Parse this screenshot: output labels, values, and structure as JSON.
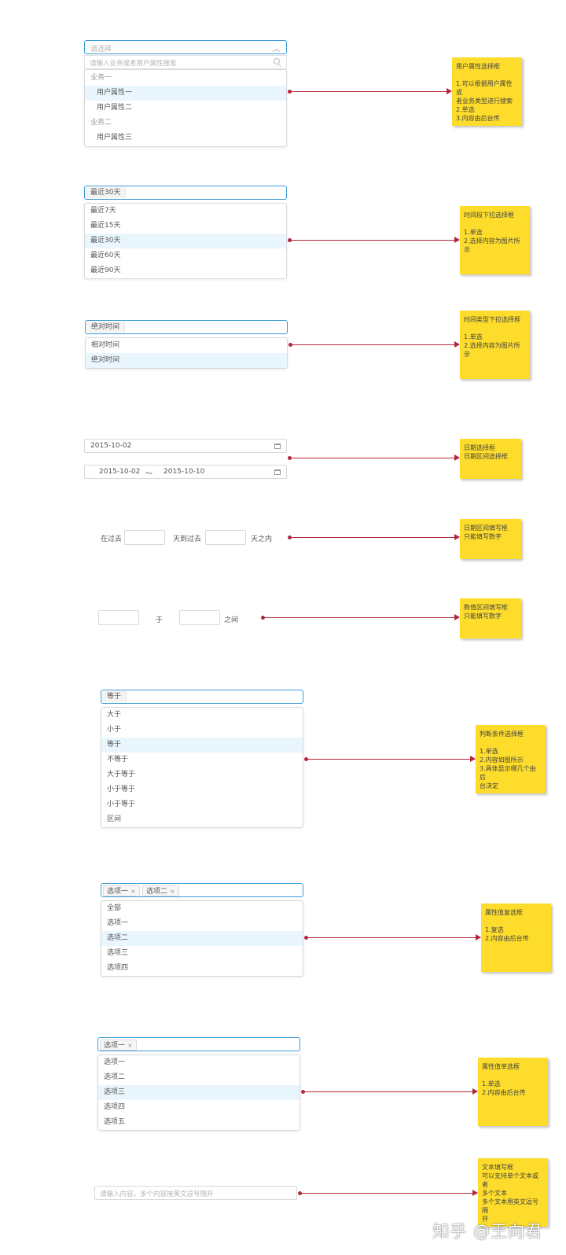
{
  "section1": {
    "placeholder": "请选择",
    "search_placeholder": "请输入业务或者用户属性搜索",
    "options": [
      {
        "label": "业务一",
        "kind": "group"
      },
      {
        "label": "用户属性一",
        "kind": "item",
        "selected": true
      },
      {
        "label": "用户属性二",
        "kind": "item"
      },
      {
        "label": "业务二",
        "kind": "group"
      },
      {
        "label": "用户属性三",
        "kind": "item"
      }
    ],
    "note": {
      "title": "用户属性选择框",
      "lines": [
        "1.可以根据用户属性或",
        "者业务类型进行搜索",
        "2.单选",
        "3.内容由后台传"
      ]
    }
  },
  "section2": {
    "value": "最近30天",
    "options": [
      "最近7天",
      "最近15天",
      "最近30天",
      "最近60天",
      "最近90天"
    ],
    "selected_index": 2,
    "note": {
      "title": "时间段下拉选择框",
      "lines": [
        "1.单选",
        "2.选择内容为图片所示"
      ]
    }
  },
  "section3": {
    "value": "绝对时间",
    "options": [
      "相对时间",
      "绝对时间"
    ],
    "selected_index": 1,
    "note": {
      "title": "时间类型下拉选择框",
      "lines": [
        "1.单选",
        "2.选择内容为图片所示"
      ]
    }
  },
  "section4": {
    "date": "2015-10-02",
    "range_start": "2015-10-02",
    "range_sep": "～",
    "range_end": "2015-10-10",
    "note": {
      "title": "日期选择框",
      "lines": [
        "日期区间选择框"
      ]
    }
  },
  "section5": {
    "prefix": "在过去",
    "middle": "天到过去",
    "suffix": "天之内",
    "note": {
      "title": "日期区间填写框",
      "lines": [
        "只能填写数字"
      ]
    }
  },
  "section6": {
    "middle": "于",
    "suffix": "之间",
    "note": {
      "title": "数值区间填写框",
      "lines": [
        "只能填写数字"
      ]
    }
  },
  "section7": {
    "value": "等于",
    "options": [
      "大于",
      "小于",
      "等于",
      "不等于",
      "大于等于",
      "小于等于",
      "小于等于",
      "区间"
    ],
    "selected_index": 2,
    "note": {
      "title": "判断条件选择框",
      "lines": [
        "1.单选",
        "2.内容如图所示",
        "3.具体显示哪几个由后",
        "台决定"
      ]
    }
  },
  "section8": {
    "tags": [
      "选项一",
      "选项二"
    ],
    "tag_close": "×",
    "options": [
      "全部",
      "选项一",
      "选项二",
      "选项三",
      "选项四"
    ],
    "selected_index": 2,
    "note": {
      "title": "属性值复选框",
      "lines": [
        "1.复选",
        "2.内容由后台传"
      ]
    }
  },
  "section9": {
    "tags": [
      "选项一"
    ],
    "tag_close": "×",
    "options": [
      "选项一",
      "选项二",
      "选项三",
      "选项四",
      "选项五"
    ],
    "selected_index": 2,
    "note": {
      "title": "属性值单选框",
      "lines": [
        "1.单选",
        "2.内容由后台传"
      ]
    }
  },
  "section10": {
    "placeholder": "请输入内容，多个内容按英文逗号隔开",
    "note": {
      "title": "文本填写框",
      "lines": [
        "可以支持单个文本或者",
        "多个文本",
        "多个文本用英文逗号隔",
        "开"
      ]
    }
  },
  "watermark": "知乎 @王向君",
  "colors": {
    "accent": "#3a9bd5",
    "note": "#fddc2b",
    "arrow": "#b3263e",
    "selected_bg": "#e9f6fd"
  }
}
